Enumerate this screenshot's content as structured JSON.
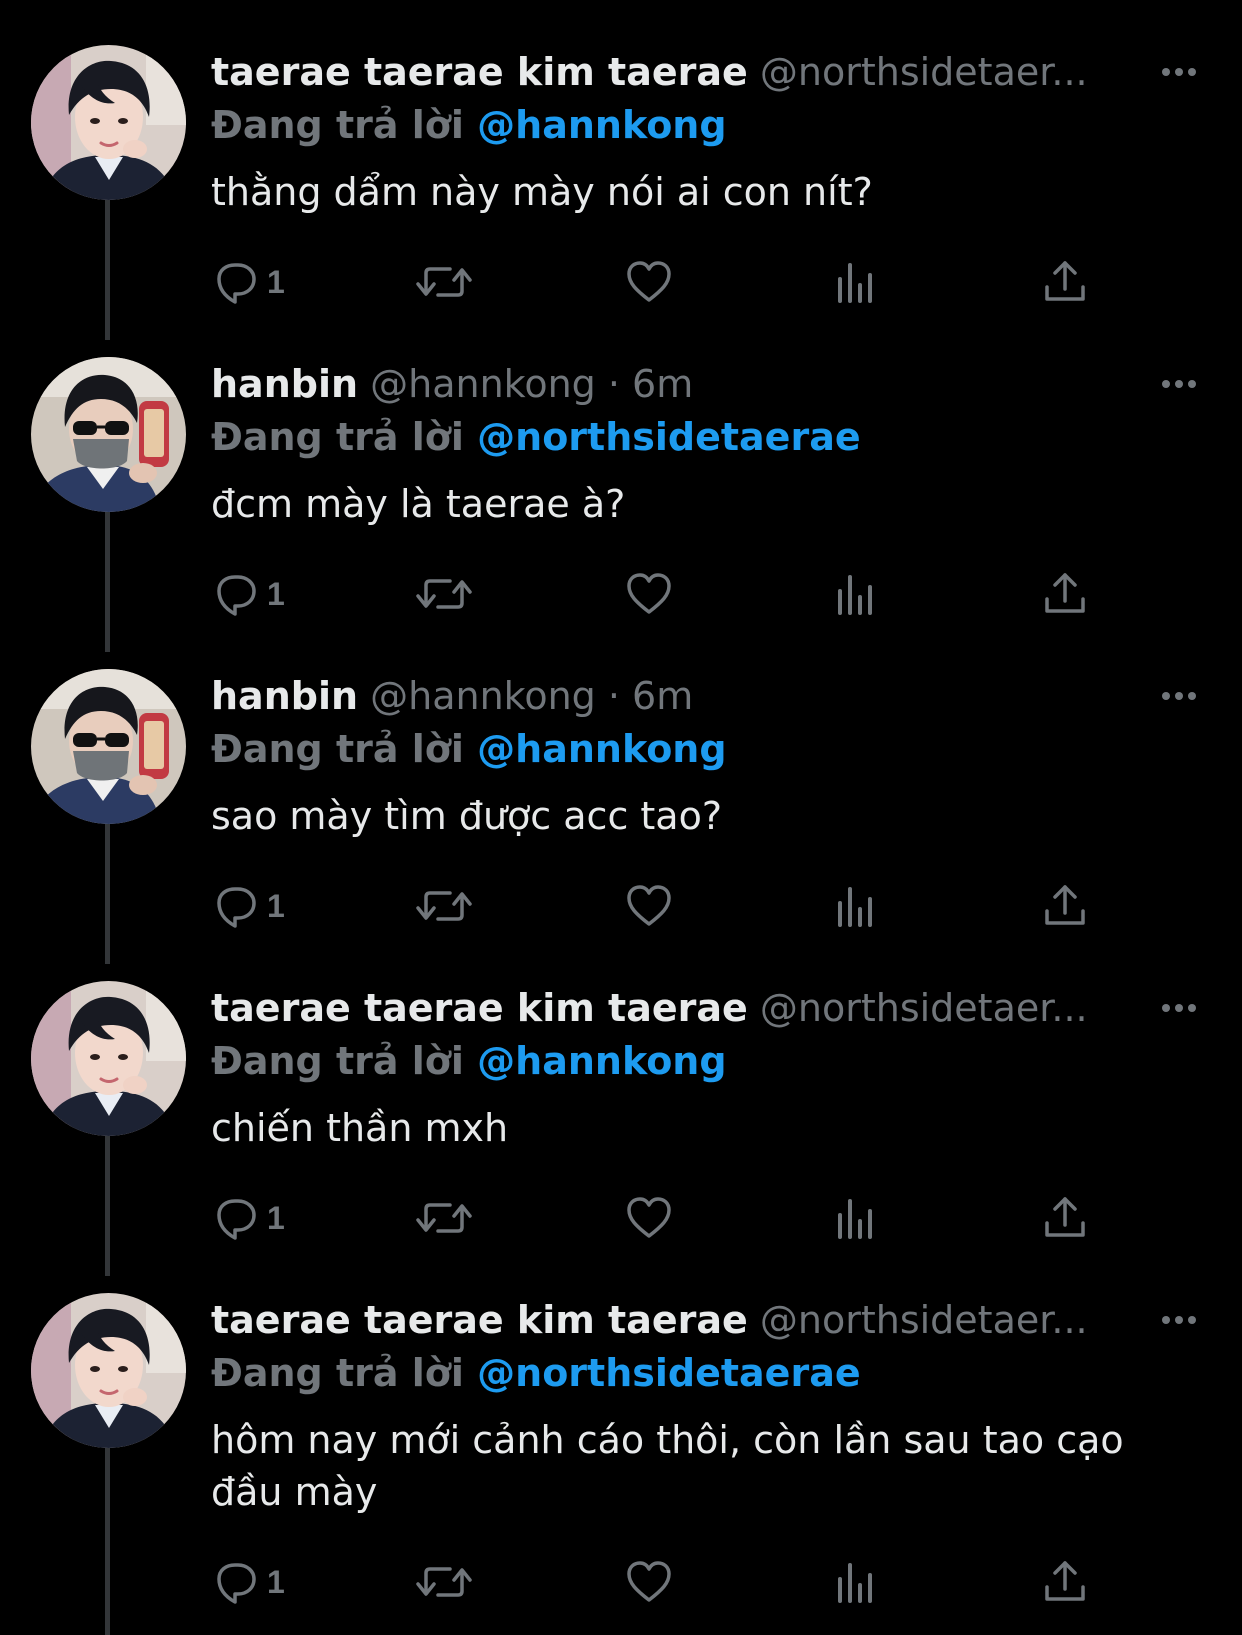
{
  "colors": {
    "background": "#000000",
    "text_primary": "#e7e9ea",
    "text_secondary": "#71767b",
    "accent": "#1d9bf0",
    "thread_line": "#333639"
  },
  "icons": {
    "more": "more-horizontal-icon",
    "reply": "reply-icon",
    "retweet": "retweet-icon",
    "like": "heart-icon",
    "views": "views-icon",
    "share": "share-icon"
  },
  "tweets": [
    {
      "name": "taerae taerae kim taerae",
      "handle": "@northsidetaer...",
      "time": "",
      "reply_label": "Đang trả lời",
      "reply_to": "@hannkong",
      "text": "thằng dẩm này mày nói ai con nít?",
      "reply_count": "1",
      "avatar": "taerae"
    },
    {
      "name": "hanbin",
      "handle": "@hannkong",
      "time": "· 6m",
      "reply_label": "Đang trả lời",
      "reply_to": "@northsidetaerae",
      "text": "đcm mày là taerae à?",
      "reply_count": "1",
      "avatar": "hanbin"
    },
    {
      "name": "hanbin",
      "handle": "@hannkong",
      "time": "· 6m",
      "reply_label": "Đang trả lời",
      "reply_to": "@hannkong",
      "text": "sao mày tìm được acc tao?",
      "reply_count": "1",
      "avatar": "hanbin"
    },
    {
      "name": "taerae taerae kim taerae",
      "handle": "@northsidetaer...",
      "time": "",
      "reply_label": "Đang trả lời",
      "reply_to": "@hannkong",
      "text": "chiến thần mxh",
      "reply_count": "1",
      "avatar": "taerae"
    },
    {
      "name": "taerae taerae kim taerae",
      "handle": "@northsidetaer...",
      "time": "",
      "reply_label": "Đang trả lời",
      "reply_to": "@northsidetaerae",
      "text": "hôm nay mới cảnh cáo thôi, còn lần sau tao cạo đầu mày",
      "reply_count": "1",
      "avatar": "taerae"
    }
  ]
}
